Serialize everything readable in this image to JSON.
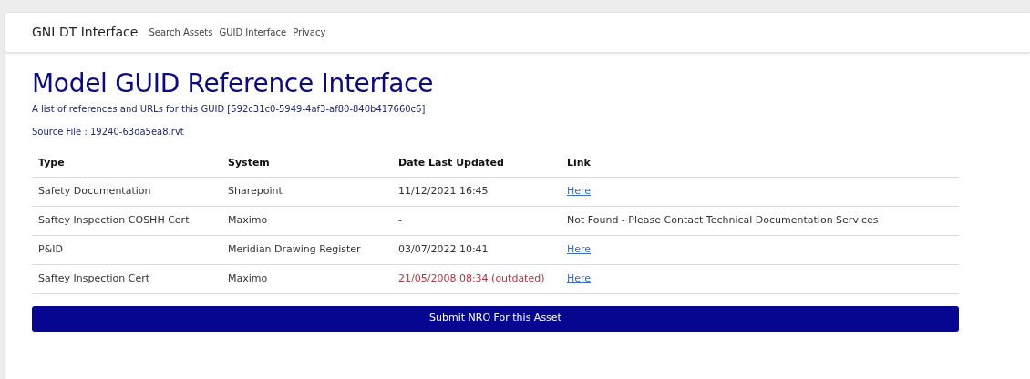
{
  "navbar": {
    "brand": "GNI DT Interface",
    "links": [
      "Search Assets",
      "GUID Interface",
      "Privacy"
    ]
  },
  "heading": "Model GUID Reference Interface",
  "subtitle": "A list of references and URLs for this GUID [592c31c0-5949-4af3-af80-840b417660c6]",
  "source_file": "Source File : 19240-63da5ea8.rvt",
  "table": {
    "columns": [
      "Type",
      "System",
      "Date Last Updated",
      "Link"
    ],
    "rows": [
      {
        "type": "Safety Documentation",
        "system": "Sharepoint",
        "date": "11/12/2021 16:45",
        "outdated": false,
        "link": {
          "kind": "link",
          "text": "Here"
        }
      },
      {
        "type": "Saftey Inspection COSHH Cert",
        "system": "Maximo",
        "date": "-",
        "outdated": false,
        "link": {
          "kind": "text",
          "text": "Not Found - Please Contact Technical Documentation Services"
        }
      },
      {
        "type": "P&ID",
        "system": "Meridian Drawing Register",
        "date": "03/07/2022 10:41",
        "outdated": false,
        "link": {
          "kind": "link",
          "text": "Here"
        }
      },
      {
        "type": "Saftey Inspection Cert",
        "system": "Maximo",
        "date": "21/05/2008 08:34 (outdated)",
        "outdated": true,
        "link": {
          "kind": "link",
          "text": "Here"
        }
      }
    ]
  },
  "submit_button": "Submit NRO For this Asset"
}
